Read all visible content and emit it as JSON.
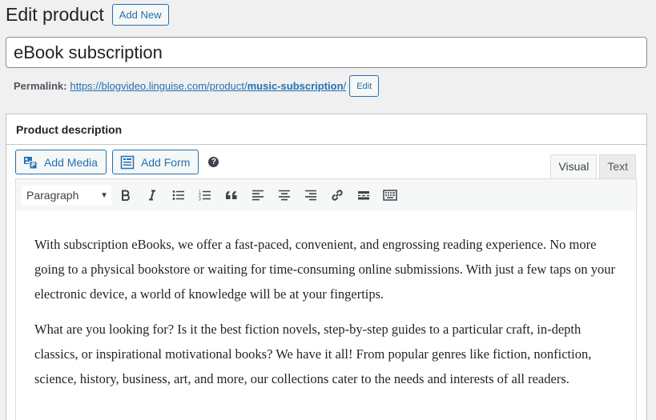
{
  "header": {
    "title": "Edit product",
    "add_new_label": "Add New"
  },
  "post_title": {
    "value": "eBook subscription"
  },
  "permalink": {
    "label": "Permalink:",
    "url_base": "https://blogvideo.linguise.com/product/",
    "slug": "music-subscription",
    "url_tail": "/",
    "edit_label": "Edit"
  },
  "description_box": {
    "title": "Product description",
    "media_buttons": [
      {
        "label": "Add Media",
        "icon": "add-media-icon"
      },
      {
        "label": "Add Form",
        "icon": "form-icon"
      }
    ],
    "help_icon": "?",
    "tabs": {
      "visual": "Visual",
      "text": "Text",
      "active": "visual"
    },
    "toolbar": {
      "format": "Paragraph",
      "buttons": [
        "bold",
        "italic",
        "bulleted-list",
        "numbered-list",
        "blockquote",
        "align-left",
        "align-center",
        "align-right",
        "insert-link",
        "read-more",
        "toolbar-toggle"
      ]
    },
    "content": [
      "With subscription eBooks, we offer a fast-paced, convenient, and engrossing reading experience. No more going to a physical bookstore or waiting for time-consuming online submissions. With just a few taps on your electronic device, a world of knowledge will be at your fingertips.",
      "What are you looking for? Is it the best fiction novels, step-by-step guides to a particular craft, in-depth classics, or inspirational motivational books? We have it all! From popular genres like fiction, nonfiction, science, history, business, art, and more, our collections cater to the needs and interests of all readers."
    ]
  },
  "colors": {
    "accent": "#2271b1",
    "background": "#f0f0f1",
    "text": "#1d2327"
  }
}
